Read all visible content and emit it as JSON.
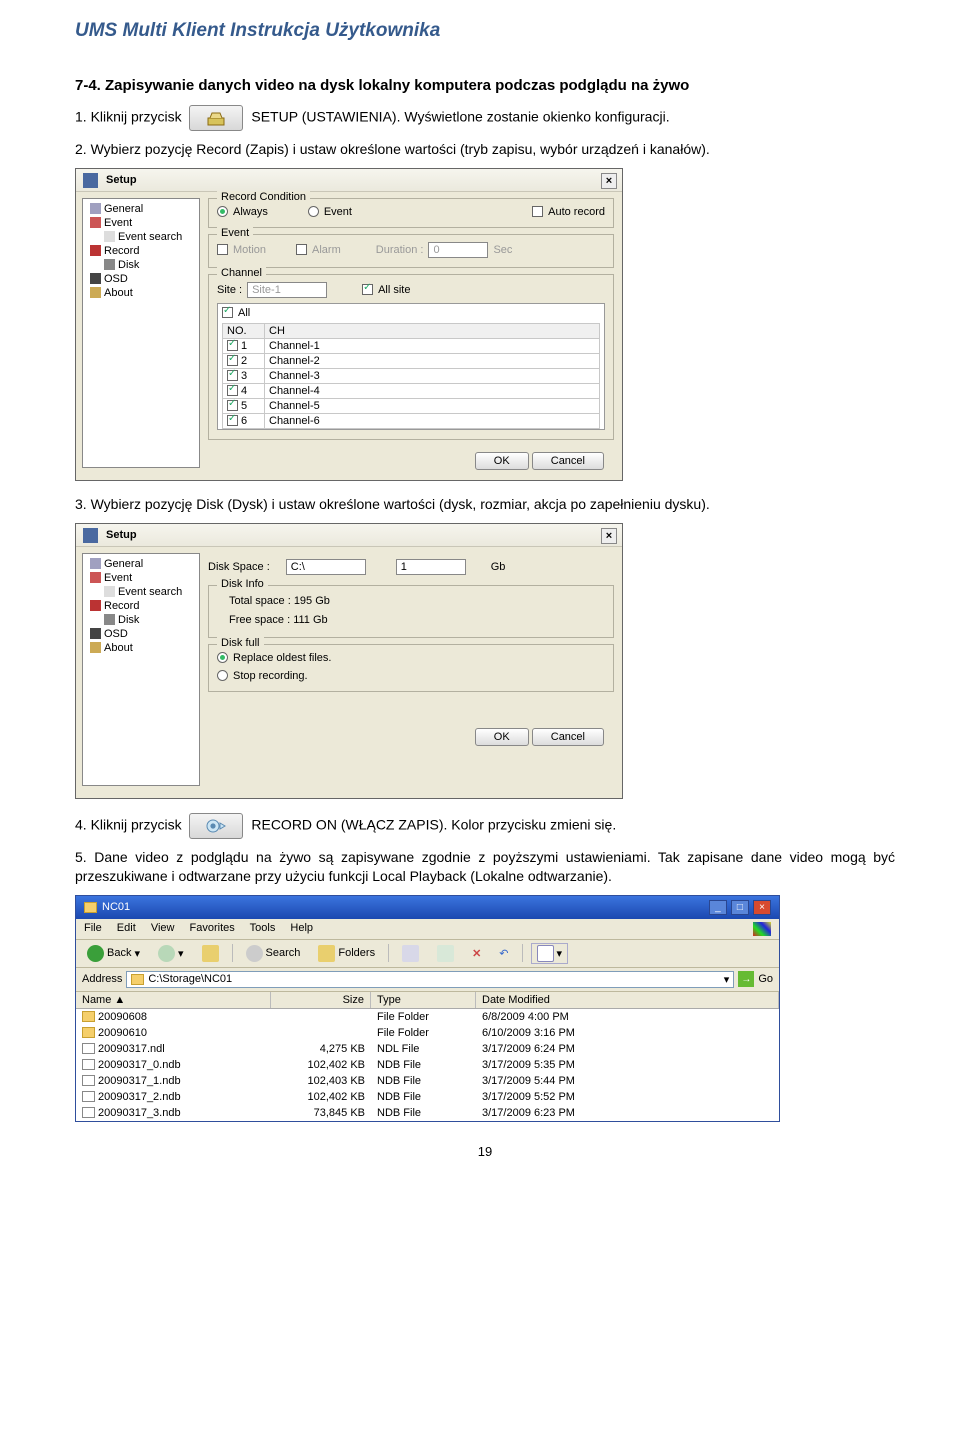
{
  "doc_title": "UMS Multi Klient Instrukcja Użytkownika",
  "heading": "7-4. Zapisywanie danych video na dysk lokalny komputera podczas podglądu na żywo",
  "step1_pre": "1. Kliknij przycisk",
  "step1_post": "SETUP (USTAWIENIA). Wyświetlone zostanie okienko konfiguracji.",
  "step2": "2. Wybierz pozycję Record (Zapis) i ustaw określone wartości (tryb zapisu, wybór urządzeń i kanałów).",
  "step3": "3. Wybierz pozycję Disk (Dysk) i ustaw określone wartości (dysk, rozmiar, akcja po zapełnieniu dysku).",
  "step4_pre": "4. Kliknij przycisk",
  "step4_post": "RECORD ON (WŁĄCZ ZAPIS). Kolor przycisku zmieni się.",
  "step5": "5. Dane video z podglądu na żywo są zapisywane zgodnie z poyższymi ustawieniami. Tak zapisane dane video mogą być przeszukiwane i odtwarzane przy użyciu funkcji Local Playback (Lokalne odtwarzanie).",
  "page_num": "19",
  "setup": {
    "title": "Setup",
    "nav": {
      "general": "General",
      "event": "Event",
      "event_search": "Event search",
      "record": "Record",
      "disk": "Disk",
      "osd": "OSD",
      "about": "About"
    },
    "buttons": {
      "ok": "OK",
      "cancel": "Cancel"
    },
    "record": {
      "cond_legend": "Record Condition",
      "always": "Always",
      "event": "Event",
      "auto": "Auto record",
      "event_legend": "Event",
      "motion": "Motion",
      "alarm": "Alarm",
      "duration_lbl": "Duration :",
      "duration_val": "0",
      "duration_unit": "Sec",
      "channel_legend": "Channel",
      "site_lbl": "Site :",
      "site_val": "Site-1",
      "allsite": "All site",
      "all": "All",
      "col_no": "NO.",
      "col_ch": "CH",
      "rows": [
        {
          "no": "1",
          "ch": "Channel-1"
        },
        {
          "no": "2",
          "ch": "Channel-2"
        },
        {
          "no": "3",
          "ch": "Channel-3"
        },
        {
          "no": "4",
          "ch": "Channel-4"
        },
        {
          "no": "5",
          "ch": "Channel-5"
        },
        {
          "no": "6",
          "ch": "Channel-6"
        }
      ]
    },
    "disk": {
      "space_legend": "Disk Space :",
      "drive": "C:\\",
      "size": "1",
      "size_unit": "Gb",
      "info_legend": "Disk Info",
      "total": "Total space : 195 Gb",
      "free": "Free space : 111 Gb",
      "full_legend": "Disk full",
      "replace": "Replace oldest files.",
      "stop": "Stop recording."
    }
  },
  "explorer": {
    "title": "NC01",
    "menu": {
      "file": "File",
      "edit": "Edit",
      "view": "View",
      "fav": "Favorites",
      "tools": "Tools",
      "help": "Help"
    },
    "toolbar": {
      "back": "Back",
      "search": "Search",
      "folders": "Folders"
    },
    "addr_label": "Address",
    "address": "C:\\Storage\\NC01",
    "go": "Go",
    "cols": {
      "name": "Name",
      "size": "Size",
      "type": "Type",
      "date": "Date Modified"
    },
    "rows": [
      {
        "icon": "folder",
        "name": "20090608",
        "size": "",
        "type": "File Folder",
        "date": "6/8/2009 4:00 PM"
      },
      {
        "icon": "folder",
        "name": "20090610",
        "size": "",
        "type": "File Folder",
        "date": "6/10/2009 3:16 PM"
      },
      {
        "icon": "file",
        "name": "20090317.ndl",
        "size": "4,275 KB",
        "type": "NDL File",
        "date": "3/17/2009 6:24 PM"
      },
      {
        "icon": "file",
        "name": "20090317_0.ndb",
        "size": "102,402 KB",
        "type": "NDB File",
        "date": "3/17/2009 5:35 PM"
      },
      {
        "icon": "file",
        "name": "20090317_1.ndb",
        "size": "102,403 KB",
        "type": "NDB File",
        "date": "3/17/2009 5:44 PM"
      },
      {
        "icon": "file",
        "name": "20090317_2.ndb",
        "size": "102,402 KB",
        "type": "NDB File",
        "date": "3/17/2009 5:52 PM"
      },
      {
        "icon": "file",
        "name": "20090317_3.ndb",
        "size": "73,845 KB",
        "type": "NDB File",
        "date": "3/17/2009 6:23 PM"
      }
    ]
  }
}
